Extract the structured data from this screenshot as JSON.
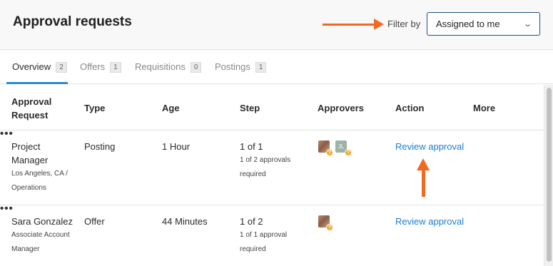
{
  "header": {
    "title": "Approval requests",
    "filter_label": "Filter by",
    "filter_value": "Assigned to me"
  },
  "tabs": [
    {
      "label": "Overview",
      "count": "2",
      "active": true
    },
    {
      "label": "Offers",
      "count": "1",
      "active": false
    },
    {
      "label": "Requisitions",
      "count": "0",
      "active": false
    },
    {
      "label": "Postings",
      "count": "1",
      "active": false
    }
  ],
  "columns": {
    "request_line1": "Approval",
    "request_line2": "Request",
    "type": "Type",
    "age": "Age",
    "step": "Step",
    "approvers": "Approvers",
    "action": "Action",
    "more": "More"
  },
  "rows": [
    {
      "title_line1": "Project",
      "title_line2": "Manager",
      "sub_line1": "Los Angeles, CA /",
      "sub_line2": "Operations",
      "type": "Posting",
      "age": "1 Hour",
      "step": "1 of 1",
      "step_sub_line1": "1 of 2 approvals",
      "step_sub_line2": "required",
      "approver_initials": "JL",
      "action": "Review approval",
      "more": "•••"
    },
    {
      "title_line1": "Sara Gonzalez",
      "sub_line1": "Associate Account",
      "sub_line2": "Manager",
      "type": "Offer",
      "age": "44 Minutes",
      "step": "1 of 2",
      "step_sub_line1": "1 of 1 approval",
      "step_sub_line2": "required",
      "action": "Review approval",
      "more": "•••"
    }
  ],
  "pending_badge": "?",
  "colors": {
    "accent_blue": "#1b7fd1",
    "tab_underline": "#2b8bd6",
    "annotation_arrow": "#f26a22",
    "pending_badge": "#f5a623"
  }
}
